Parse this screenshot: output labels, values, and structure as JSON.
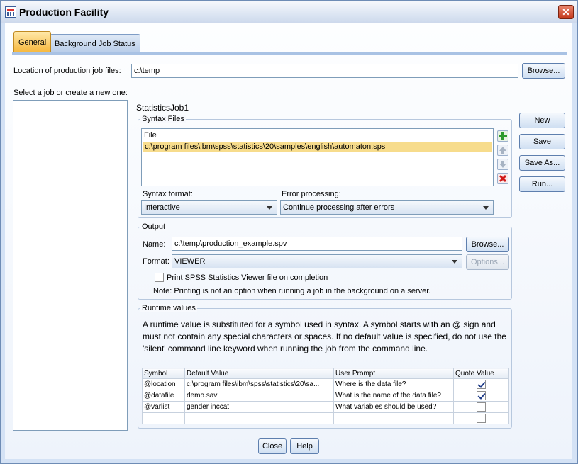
{
  "window": {
    "title": "Production Facility"
  },
  "tabs": [
    {
      "label": "General",
      "active": true
    },
    {
      "label": "Background Job Status",
      "active": false
    }
  ],
  "location": {
    "label": "Location of production job files:",
    "value": "c:\\temp",
    "browse_label": "Browse..."
  },
  "job_list": {
    "label": "Select a job or create a new one:"
  },
  "job": {
    "name": "StatisticsJob1"
  },
  "actions": {
    "new_label": "New",
    "save_label": "Save",
    "save_as_label": "Save As...",
    "run_label": "Run..."
  },
  "syntax_files": {
    "group_title": "Syntax Files",
    "header": "File",
    "files": [
      "c:\\program files\\ibm\\spss\\statistics\\20\\samples\\english\\automaton.sps"
    ],
    "format_label": "Syntax format:",
    "format_value": "Interactive",
    "error_label": "Error processing:",
    "error_value": "Continue processing after errors"
  },
  "output": {
    "group_title": "Output",
    "name_label": "Name:",
    "name_value": "c:\\temp\\production_example.spv",
    "browse_label": "Browse...",
    "format_label": "Format:",
    "format_value": "VIEWER",
    "options_label": "Options...",
    "print_label": "Print SPSS Statistics Viewer file on completion",
    "note": "Note: Printing is not an option when running a job in the background on a server."
  },
  "runtime": {
    "group_title": "Runtime values",
    "description": "A runtime value is substituted for a symbol used in syntax. A symbol starts with an @ sign and must not contain any special characters or spaces. If no default value is specified, do not use the 'silent' command line keyword when running the job from the command line.",
    "columns": [
      "Symbol",
      "Default Value",
      "User Prompt",
      "Quote Value"
    ],
    "rows": [
      {
        "symbol": "@location",
        "default": "c:\\program files\\ibm\\spss\\statistics\\20\\sa...",
        "prompt": "Where is the data file?",
        "quote": true
      },
      {
        "symbol": "@datafile",
        "default": "demo.sav",
        "prompt": "What is the name of the data file?",
        "quote": true
      },
      {
        "symbol": "@varlist",
        "default": "gender inccat",
        "prompt": " What variables should be used?",
        "quote": false
      },
      {
        "symbol": "",
        "default": "",
        "prompt": "",
        "quote": false
      }
    ]
  },
  "footer": {
    "close_label": "Close",
    "help_label": "Help"
  }
}
